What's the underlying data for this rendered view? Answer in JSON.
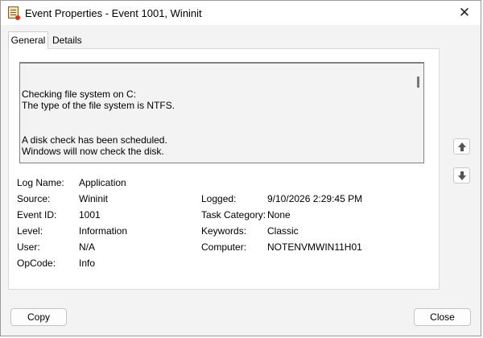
{
  "window": {
    "title": "Event Properties - Event 1001, Wininit",
    "close_glyph": "✕"
  },
  "tabs": [
    {
      "label": "General",
      "selected": true
    },
    {
      "label": "Details",
      "selected": false
    }
  ],
  "description_lines": [
    "Checking file system on C:",
    "The type of the file system is NTFS.",
    "A disk check has been scheduled.",
    "Windows will now check the disk."
  ],
  "fields_left": [
    {
      "label": "Log Name:",
      "value": "Application"
    },
    {
      "label": "Source:",
      "value": "Wininit"
    },
    {
      "label": "Event ID:",
      "value": "1001"
    },
    {
      "label": "Level:",
      "value": "Information"
    },
    {
      "label": "User:",
      "value": "N/A"
    },
    {
      "label": "OpCode:",
      "value": "Info"
    }
  ],
  "fields_right": [
    {
      "label": "Logged:",
      "value": "9/10/2026 2:29:45 PM"
    },
    {
      "label": "Task Category:",
      "value": "None"
    },
    {
      "label": "Keywords:",
      "value": "Classic"
    },
    {
      "label": "Computer:",
      "value": "NOTENVMWIN11H01"
    }
  ],
  "icons": {
    "app": "event-viewer-icon",
    "up": "arrow-up-icon",
    "down": "arrow-down-icon"
  },
  "buttons": {
    "copy": "Copy",
    "close": "Close"
  },
  "colors": {
    "window_bg": "#f3f3f3",
    "panel_bg": "#ffffff",
    "arrow": "#555555"
  }
}
